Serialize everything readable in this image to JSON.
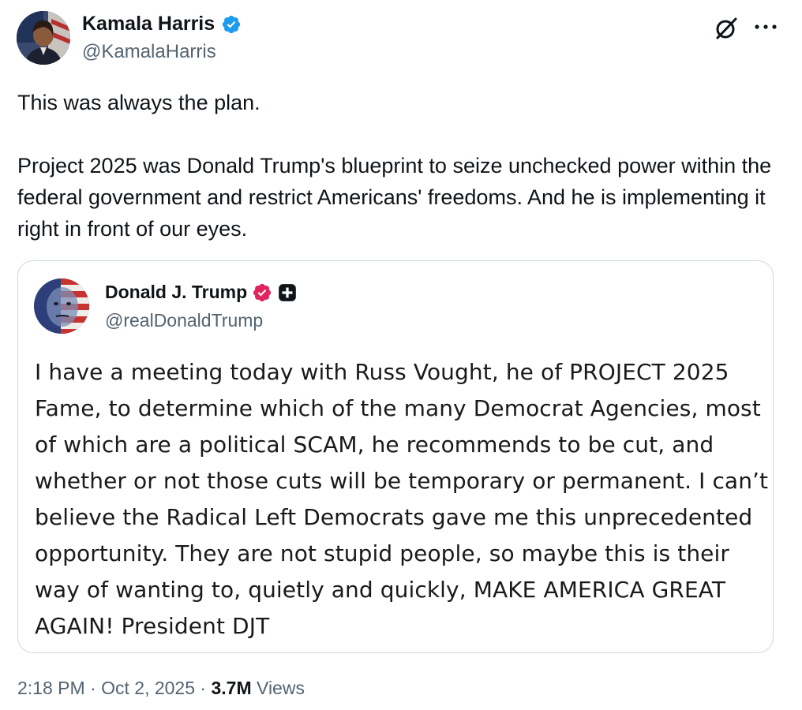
{
  "colors": {
    "text_primary": "#0f1419",
    "text_secondary": "#536471",
    "verified_blue": "#1d9bf0",
    "verified_pink": "#e0245e",
    "border": "#cfd9de"
  },
  "author": {
    "name": "Kamala Harris",
    "handle": "@KamalaHarris",
    "avatar_icon": "profile-photo",
    "badge_icon": "verified-checkmark-icon"
  },
  "tweet": {
    "paragraph_1": "This was always the plan.",
    "paragraph_2": "Project 2025 was Donald Trump's blueprint to seize unchecked power within the federal government and restrict Americans' freedoms. And he is implementing it right in front of our eyes."
  },
  "quoted": {
    "name": "Donald J. Trump",
    "handle": "@realDonaldTrump",
    "badge_icon": "verified-badge-icon",
    "extra_icon": "plus-square-icon",
    "text": "I have a meeting today with Russ Vought, he of PROJECT 2025 Fame,  to determine which of the many Democrat Agencies, most of which are a political SCAM, he recommends to be cut, and whether or not those cuts will be temporary or permanent. I can’t believe the Radical Left Democrats gave me this unprecedented opportunity. They are not stupid people, so maybe this is their way of wanting to, quietly and quickly, MAKE AMERICA GREAT AGAIN! President DJT"
  },
  "meta": {
    "time": "2:18 PM",
    "separator_1": " · ",
    "date": "Oct 2, 2025",
    "separator_2": " · ",
    "views_count": "3.7M",
    "views_label": " Views"
  },
  "actions": {
    "grok_icon": "grok-icon",
    "more_icon": "more-icon"
  }
}
